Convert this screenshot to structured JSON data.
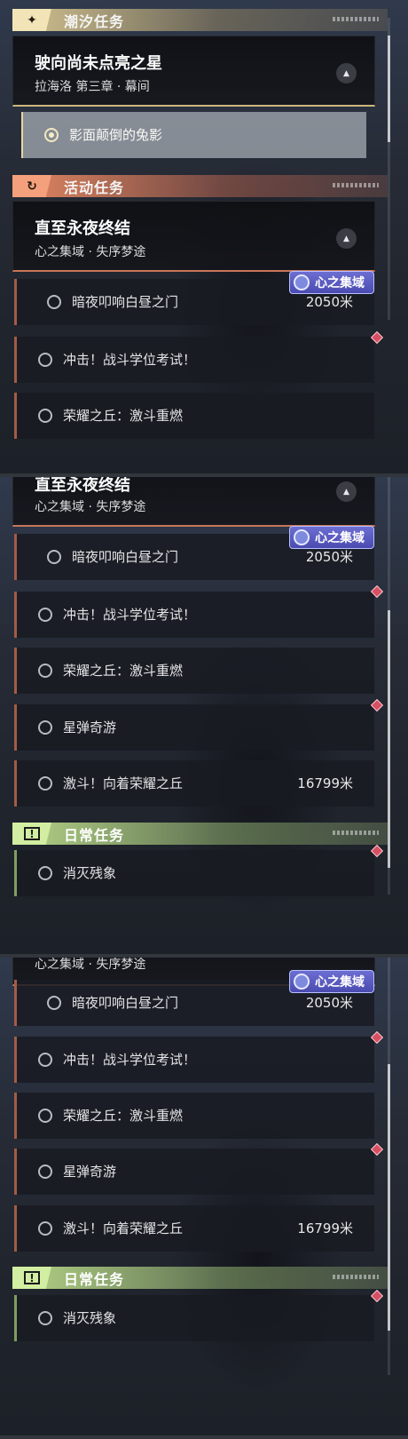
{
  "categories": {
    "tide": {
      "label": "潮汐任务",
      "icon": "sparkle-icon",
      "glyph": "✦",
      "color": "#f2e4b6"
    },
    "event": {
      "label": "活动任务",
      "icon": "event-icon",
      "glyph": "↻",
      "color": "#f5a07c"
    },
    "daily": {
      "label": "日常任务",
      "icon": "alert-icon",
      "glyph": "!",
      "color": "#d2eea2"
    }
  },
  "tide_group": {
    "title": "驶向尚未点亮之星",
    "subtitle": "拉海洛 第三章 · 幕间",
    "active_quest": "影面颠倒的兔影"
  },
  "event_group": {
    "title": "直至永夜终结",
    "subtitle": "心之集域 · 失序梦途",
    "region_badge": "心之集域",
    "quests": [
      {
        "label": "暗夜叩响白昼之门",
        "distance": "2050米"
      },
      {
        "label": "冲击！战斗学位考试！",
        "distance": ""
      },
      {
        "label": "荣耀之丘：激斗重燃",
        "distance": ""
      },
      {
        "label": "星弹奇游",
        "distance": ""
      },
      {
        "label": "激斗！向着荣耀之丘",
        "distance": "16799米"
      }
    ]
  },
  "daily_group": {
    "quests": [
      {
        "label": "消灭残象"
      }
    ]
  },
  "collapse_glyph": "▲"
}
